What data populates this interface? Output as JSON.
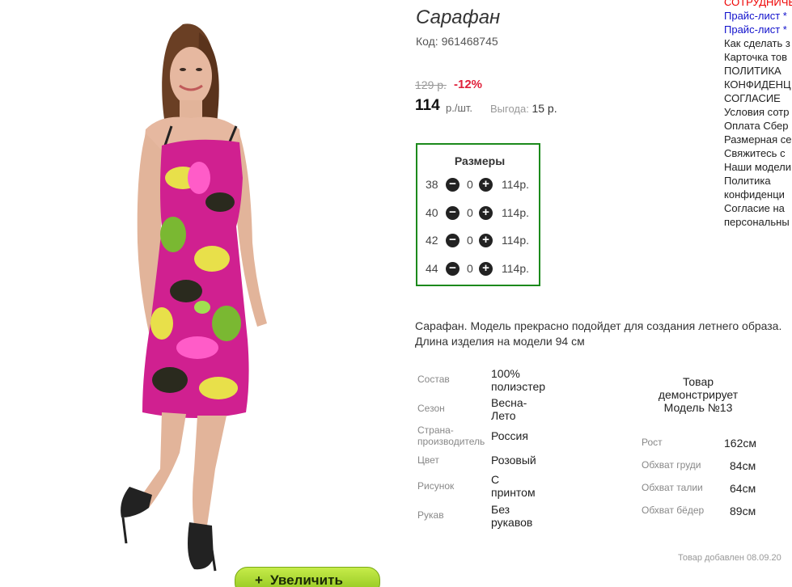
{
  "product": {
    "title": "Сарафан",
    "code": "Код: 961468745",
    "old_price": "129 р.",
    "discount": "-12%",
    "price": "114",
    "price_unit": "р./шт.",
    "profit_label": "Выгода:",
    "profit_value": "15 р.",
    "zoom_label": "Увеличить"
  },
  "sizes": {
    "title": "Размеры",
    "rows": [
      {
        "size": "38",
        "qty": "0",
        "price": "114р."
      },
      {
        "size": "40",
        "qty": "0",
        "price": "114р."
      },
      {
        "size": "42",
        "qty": "0",
        "price": "114р."
      },
      {
        "size": "44",
        "qty": "0",
        "price": "114р."
      }
    ]
  },
  "description": {
    "line1": "Сарафан. Модель прекрасно подойдет для создания летнего образа.",
    "line2": "Длина изделия на модели 94 см"
  },
  "attributes": [
    {
      "name": "Состав",
      "value1": "100%",
      "value2": "полиэстер"
    },
    {
      "name": "Сезон",
      "value1": "Весна-",
      "value2": "Лето"
    },
    {
      "name1": "Страна-",
      "name2": "производитель",
      "value1": "Россия",
      "value2": ""
    },
    {
      "name": "Цвет",
      "value1": "Розовый",
      "value2": ""
    },
    {
      "name": "Рисунок",
      "value1": "С",
      "value2": "принтом"
    },
    {
      "name": "Рукав",
      "value1": "Без",
      "value2": "рукавов"
    }
  ],
  "model": {
    "title_line1": "Товар",
    "title_line2": "демонстрирует",
    "title_line3": "Модель №13",
    "params": [
      {
        "name": "Рост",
        "value": "162см"
      },
      {
        "name": "Обхват груди",
        "value": "84см"
      },
      {
        "name": "Обхват талии",
        "value": "64см"
      },
      {
        "name": "Обхват бёдер",
        "value": "89см"
      }
    ]
  },
  "added": "Товар добавлен 08.09.20",
  "right_links": [
    "СОТРУДНИЧЕ",
    "Прайс-лист *",
    "Прайс-лист *",
    "Как сделать з",
    "Карточка тов",
    "ПОЛИТИКА",
    "КОНФИДЕНЦ",
    "СОГЛАСИЕ",
    "Условия сотр",
    "Оплата Сбер",
    "Размерная се",
    "Свяжитесь с",
    "Наши модели",
    "Политика",
    "конфиденци",
    "Согласие на",
    "персональны"
  ],
  "colors": {
    "discount": "#e0203a",
    "sizes_border": "#1c8a1c",
    "zoom_button": "#a6d52c",
    "link_red": "#ee0000",
    "link_blue": "#1111cc"
  }
}
